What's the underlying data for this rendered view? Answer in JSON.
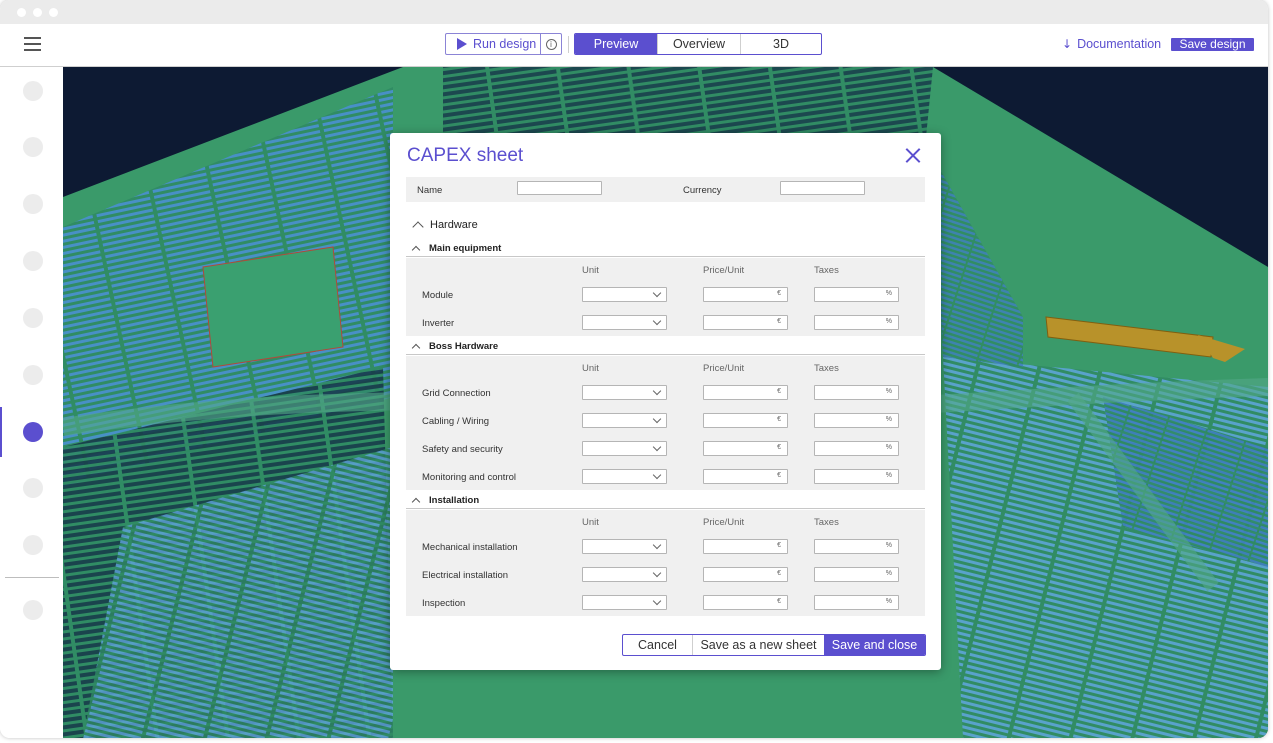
{
  "toolbar": {
    "run_label": "Run design",
    "info_icon": "info-icon",
    "tabs": [
      {
        "label": "Preview",
        "active": true
      },
      {
        "label": "Overview",
        "active": false
      },
      {
        "label": "3D",
        "active": false
      }
    ],
    "documentation_label": "Documentation",
    "save_design_label": "Save design"
  },
  "colors": {
    "accent": "#5b4fcf",
    "terrain": "#3a9a6a",
    "sky": "#0d1a33"
  },
  "modal": {
    "title": "CAPEX sheet",
    "name_label": "Name",
    "name_value": "",
    "currency_label": "Currency",
    "currency_value": "",
    "hardware_label": "Hardware",
    "columns": {
      "unit": "Unit",
      "price": "Price/Unit",
      "taxes": "Taxes"
    },
    "currency_suffix": "€",
    "percent_suffix": "%",
    "sections": [
      {
        "title": "Main equipment",
        "rows": [
          "Module",
          "Inverter"
        ]
      },
      {
        "title": "Boss Hardware",
        "rows": [
          "Grid Connection",
          "Cabling / Wiring",
          "Safety and security",
          "Monitoring and control"
        ]
      },
      {
        "title": "Installation",
        "rows": [
          "Mechanical installation",
          "Electrical installation",
          "Inspection"
        ]
      }
    ],
    "buttons": {
      "cancel": "Cancel",
      "save_new": "Save as a new sheet",
      "save_close": "Save and close"
    }
  }
}
